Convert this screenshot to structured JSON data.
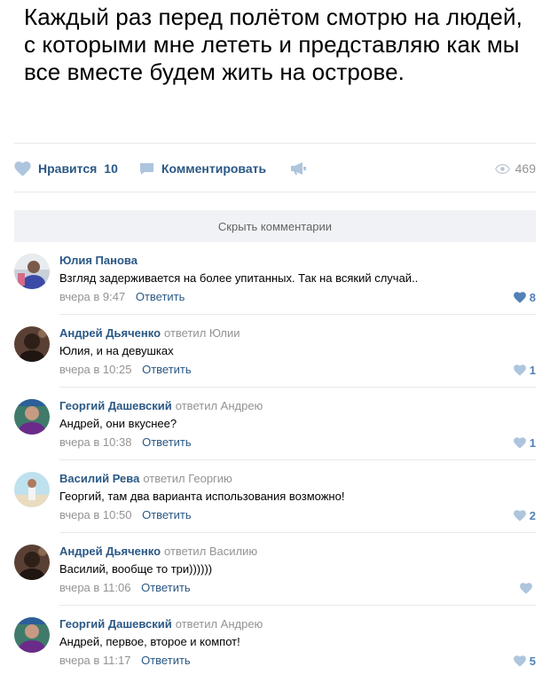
{
  "post": {
    "text": "Каждый раз перед полётом смотрю на людей, с которыми мне лететь и представляю как мы все вместе будем жить на острове."
  },
  "actions": {
    "like_label": "Нравится",
    "like_count": "10",
    "comment_label": "Комментировать",
    "views_count": "469",
    "like_icon": "heart-icon",
    "comment_icon": "comment-bubble-icon",
    "share_icon": "megaphone-icon",
    "views_icon": "eye-icon"
  },
  "hide_comments_label": "Скрыть комментарии",
  "colors": {
    "link": "#2a5885",
    "muted": "#939393",
    "heart_active": "#5181b8",
    "heart_inactive": "#aec5de",
    "button_bg": "#f0f2f5"
  },
  "comments": [
    {
      "author": "Юлия Панова",
      "reply_to": "",
      "text": "Взгляд задерживается на более упитанных. Так на всякий случай..",
      "date": "вчера в 9:47",
      "reply_label": "Ответить",
      "likes": "8",
      "liked": true
    },
    {
      "author": "Андрей Дьяченко",
      "reply_to": "ответил Юлии",
      "text": "Юлия, и на девушках",
      "date": "вчера в 10:25",
      "reply_label": "Ответить",
      "likes": "1",
      "liked": false
    },
    {
      "author": "Георгий Дашевский",
      "reply_to": "ответил Андрею",
      "text": "Андрей, они вкуснее?",
      "date": "вчера в 10:38",
      "reply_label": "Ответить",
      "likes": "1",
      "liked": false
    },
    {
      "author": "Василий Рева",
      "reply_to": "ответил Георгию",
      "text": "Георгий, там два варианта использования возможно!",
      "date": "вчера в 10:50",
      "reply_label": "Ответить",
      "likes": "2",
      "liked": false
    },
    {
      "author": "Андрей Дьяченко",
      "reply_to": "ответил Василию",
      "text": "Василий, вообще то три))))))",
      "date": "вчера в 11:06",
      "reply_label": "Ответить",
      "likes": "",
      "liked": false
    },
    {
      "author": "Георгий Дашевский",
      "reply_to": "ответил Андрею",
      "text": "Андрей, первое, второе и компот!",
      "date": "вчера в 11:17",
      "reply_label": "Ответить",
      "likes": "5",
      "liked": false
    }
  ]
}
